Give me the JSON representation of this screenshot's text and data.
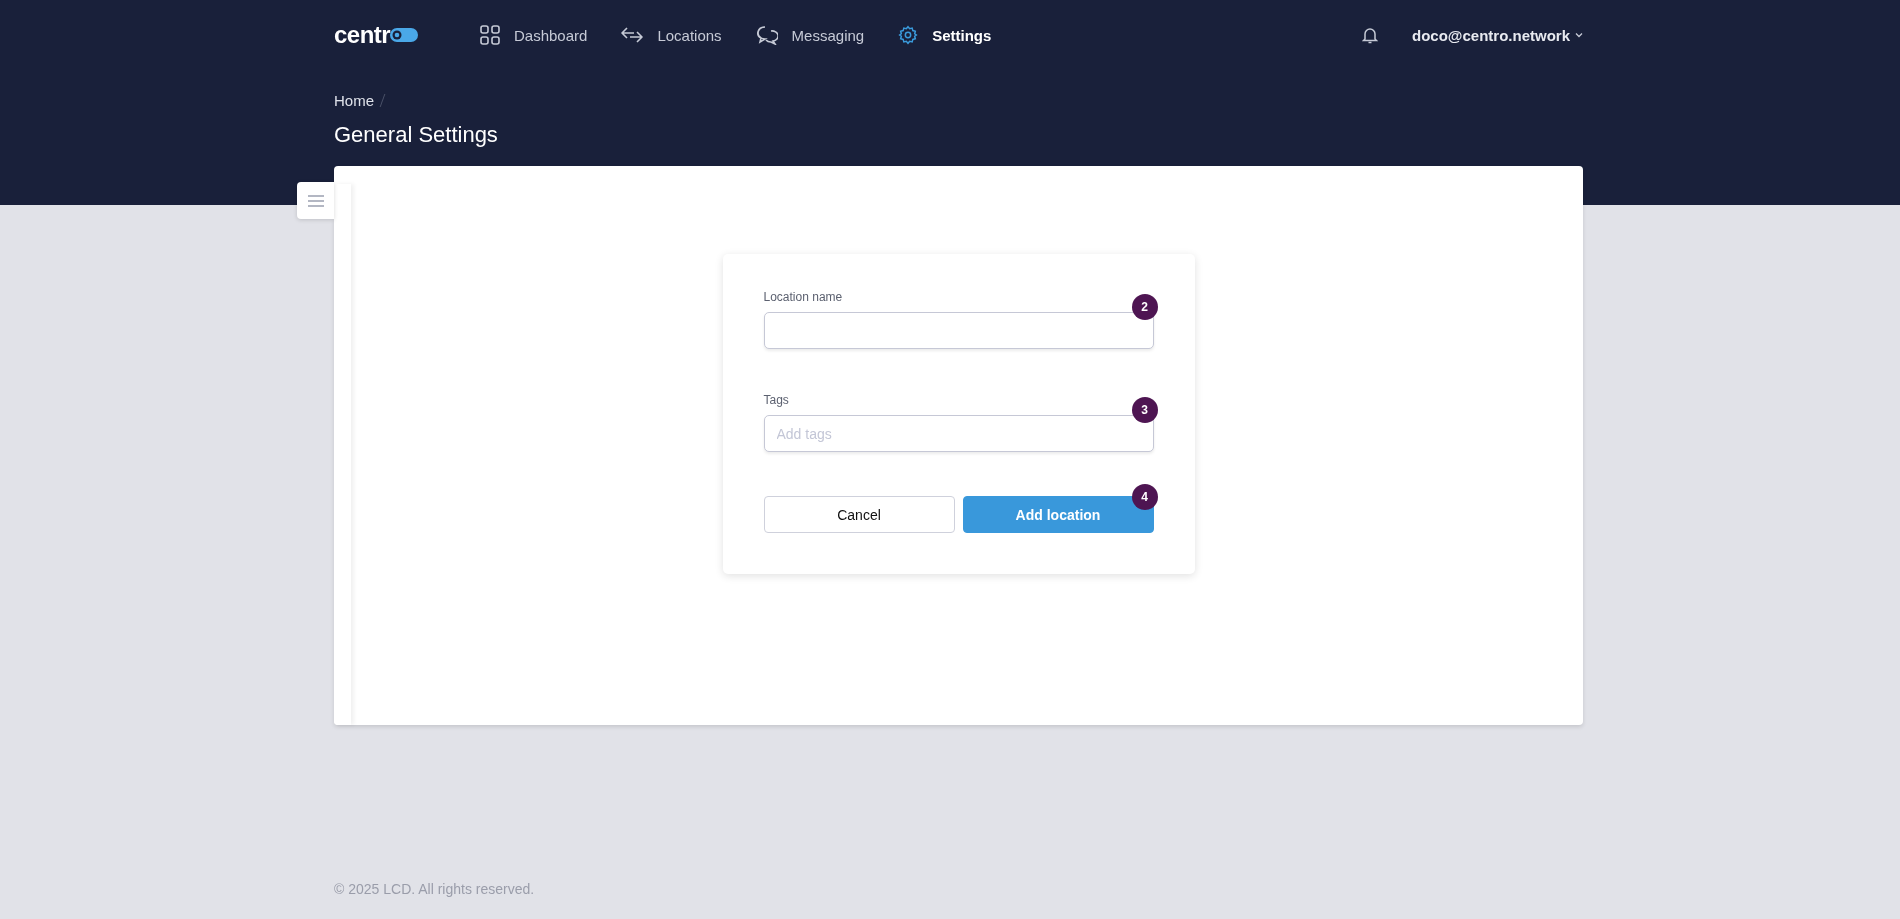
{
  "logo": {
    "text": "centr"
  },
  "nav": [
    {
      "label": "Dashboard",
      "selected": false
    },
    {
      "label": "Locations",
      "selected": false
    },
    {
      "label": "Messaging",
      "selected": false
    },
    {
      "label": "Settings",
      "selected": true
    }
  ],
  "user": {
    "email": "doco@centro.network"
  },
  "breadcrumb": [
    "Home"
  ],
  "page_title": "General Settings",
  "form": {
    "fields": [
      {
        "label": "Location name",
        "badge": "2"
      },
      {
        "label": "Tags",
        "placeholder": "Add tags",
        "badge": "3"
      }
    ],
    "buttons": [
      {
        "label": "Cancel",
        "kind": "secondary"
      },
      {
        "label": "Add location",
        "kind": "primary",
        "badge": "4"
      }
    ]
  },
  "footer": "© 2025 LCD. All rights reserved."
}
